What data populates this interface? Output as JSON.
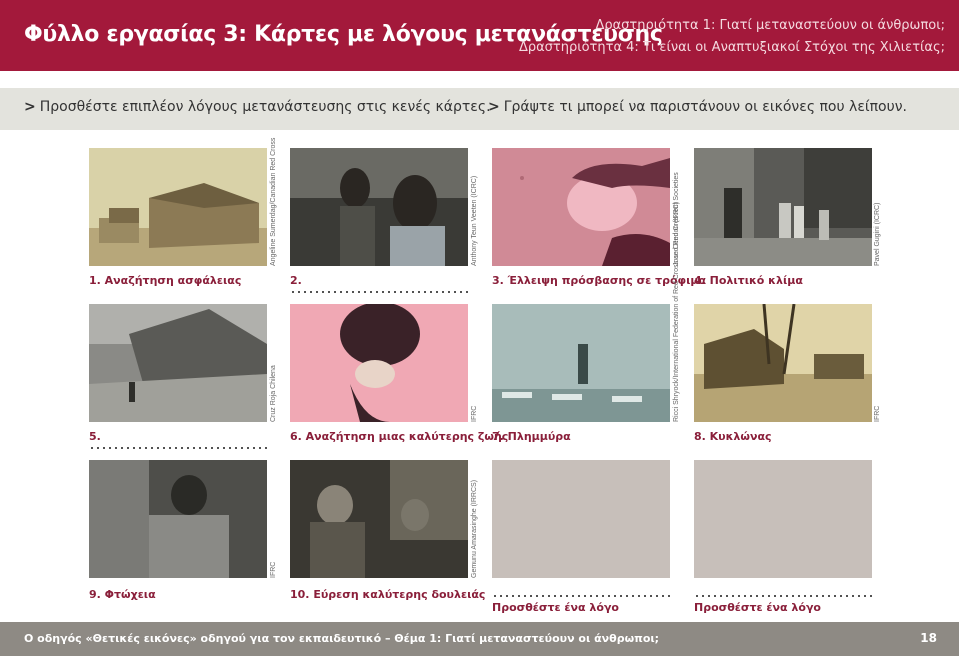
{
  "header": {
    "title": "Φύλλο εργασίας 3: Κάρτες με λόγους μετανάστευσης",
    "activity_1": "Δραστηριότητα 1: Γιατί μεταναστεύουν οι άνθρωποι;",
    "activity_4": "Δραστηριότητα 4: Τι είναι οι Αναπτυξιακοί Στόχοι της Χιλιετίας;"
  },
  "instructions": {
    "left": "Προσθέστε επιπλέον λόγους μετανάστευσης στις κενές κάρτες.",
    "right": "Γράψτε τι μπορεί να παριστάνουν οι εικόνες που λείπουν.",
    "marker": ">"
  },
  "cards": [
    {
      "caption": "1. Αναζήτηση ασφάλειας",
      "credit": "Angeline Sumerdag/Canadian Red Cross"
    },
    {
      "caption": "2.",
      "credit": "Anthony Teun Veeten (ICRC)"
    },
    {
      "caption": "3. Έλλειψη πρόσβασης σε τρόφιμα",
      "credit": "Jose Cendon (IFRC)"
    },
    {
      "caption": "4. Πολιτικό κλίμα",
      "credit": "Pavel Gugini (ICRC)"
    },
    {
      "caption": "5.",
      "credit": "Cruz Roja Chilena"
    },
    {
      "caption": "6. Αναζήτηση μιας καλύτερης ζωής",
      "credit": "IFRC"
    },
    {
      "caption": "7. Πλημμύρα",
      "credit": "Ricci Shryock/International Federation of Red Cross and Red Crescent Societies"
    },
    {
      "caption": "8. Κυκλώνας",
      "credit": "IFRC"
    },
    {
      "caption": "9. Φτώχεια",
      "credit": "IFRC"
    },
    {
      "caption": "10. Εύρεση καλύτερης δουλειάς",
      "credit": "Gemunu Amarasinghe (IRRCS)"
    }
  ],
  "add_word": "Προσθέστε ένα λόγο",
  "footer": {
    "text": "Ο οδηγός «Θετικές εικόνες» οδηγού για τον εκπαιδευτικό – Θέμα 1: Γιατί μεταναστεύουν οι άνθρωποι;",
    "page": "18"
  },
  "colors": {
    "header_bg": "#a3193b",
    "caption": "#8a1f3a",
    "footer_bg": "#8e8a84",
    "placeholder": "#c7bfba"
  }
}
